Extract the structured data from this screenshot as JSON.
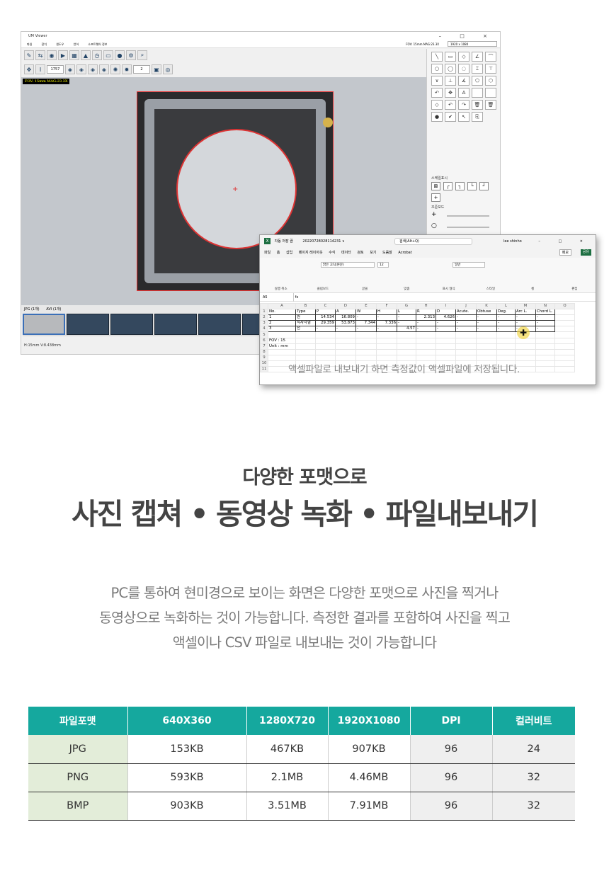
{
  "viewer": {
    "title": "UM Viewer",
    "window_controls": "– □ ×",
    "menu": [
      "파일",
      "장치",
      "윈도우",
      "언어",
      "소프트웨어 정보"
    ],
    "fov_mag": "FOV: 15mm   MAG:23.3X",
    "resolution": "1920 x 1080",
    "overlay_label": "FOV: 15mm MAG:23.3X",
    "zoom_field": "1757",
    "step_field": "2",
    "scale_panel_label": "스케일표시",
    "zoom_panel_label": "조준모드",
    "tabs": [
      "JPG (1개)",
      "AVI (1개)"
    ],
    "status": "H:15mm V:8.438mm"
  },
  "excel": {
    "autosave": "자동 저장",
    "toggle": "끔",
    "filename": "20220728028114231 ∨",
    "search_placeholder": "검색(Alt+Q)",
    "user": "lee shinho",
    "window_controls": "– □ ×",
    "menu": [
      "파일",
      "홈",
      "삽입",
      "페이지 레이아웃",
      "수식",
      "데이터",
      "검토",
      "보기",
      "도움말",
      "Acrobat"
    ],
    "memo": "메모",
    "share": "공유",
    "font_name": "맑은 고딕(본문)",
    "font_size": "12",
    "number_format": "일반",
    "ribbon_groups": [
      "실행 취소",
      "클립보드",
      "글꼴",
      "맞춤",
      "표시 형식",
      "스타일",
      "셀",
      "편집"
    ],
    "cell_ref": "A5",
    "fx": "fx",
    "columns": [
      "",
      "A",
      "B",
      "C",
      "D",
      "E",
      "F",
      "G",
      "H",
      "I",
      "J",
      "K",
      "L",
      "M",
      "N",
      "O"
    ],
    "rows": [
      [
        "1",
        "No.",
        "Type",
        "P",
        "A",
        "W",
        "H",
        "L",
        "R",
        "D",
        "Acute.",
        "Obtuse",
        "Deg.",
        "Arc L.",
        "Chord L.",
        ""
      ],
      [
        "2",
        "1",
        "원",
        "14.534",
        "16.809",
        "-",
        "-",
        "-",
        "2.313",
        "4.626",
        "-",
        "-",
        "-",
        "-",
        "-",
        ""
      ],
      [
        "3",
        "2",
        "직사각형",
        "29.359",
        "53.873",
        "7.344",
        "7.336",
        "-",
        "-",
        "-",
        "-",
        "-",
        "-",
        "-",
        "-",
        ""
      ],
      [
        "4",
        "3",
        "선",
        "-",
        "-",
        "-",
        "-",
        "4.57",
        "-",
        "-",
        "-",
        "-",
        "-",
        "-",
        "-",
        ""
      ],
      [
        "5",
        "",
        "",
        "",
        "",
        "",
        "",
        "",
        "",
        "",
        "",
        "",
        "",
        "",
        "",
        ""
      ],
      [
        "6",
        "FOV : 15",
        "",
        "",
        "",
        "",
        "",
        "",
        "",
        "",
        "",
        "",
        "",
        "",
        "",
        ""
      ],
      [
        "7",
        "Unit : mm",
        "",
        "",
        "",
        "",
        "",
        "",
        "",
        "",
        "",
        "",
        "",
        "",
        "",
        ""
      ],
      [
        "8",
        "",
        "",
        "",
        "",
        "",
        "",
        "",
        "",
        "",
        "",
        "",
        "",
        "",
        "",
        ""
      ],
      [
        "9",
        "",
        "",
        "",
        "",
        "",
        "",
        "",
        "",
        "",
        "",
        "",
        "",
        "",
        "",
        ""
      ],
      [
        "10",
        "",
        "",
        "",
        "",
        "",
        "",
        "",
        "",
        "",
        "",
        "",
        "",
        "",
        "",
        ""
      ],
      [
        "11",
        "",
        "",
        "",
        "",
        "",
        "",
        "",
        "",
        "",
        "",
        "",
        "",
        "",
        "",
        ""
      ]
    ],
    "note": "액셀파일로 내보내기 하면 측정값이 액셀파일에 저장됩니다."
  },
  "headings": {
    "sub": "다양한 포맷으로",
    "main": "사진 캡쳐 • 동영상 녹화 • 파일내보내기"
  },
  "description": [
    "PC를 통하여 현미경으로 보이는 화면은 다양한 포맷으로 사진을 찍거나",
    "동영상으로 녹화하는 것이 가능합니다. 측정한 결과를 포함하여 사진을 찍고",
    "액셀이나 CSV 파일로 내보내는 것이 가능합니다"
  ],
  "spec_table": {
    "headers": [
      "파일포맷",
      "640X360",
      "1280X720",
      "1920X1080",
      "DPI",
      "컬러비트"
    ],
    "rows": [
      [
        "JPG",
        "153KB",
        "467KB",
        "907KB",
        "96",
        "24"
      ],
      [
        "PNG",
        "593KB",
        "2.1MB",
        "4.46MB",
        "96",
        "32"
      ],
      [
        "BMP",
        "903KB",
        "3.51MB",
        "7.91MB",
        "96",
        "32"
      ]
    ]
  },
  "colors": {
    "table_header": "#15a89e",
    "format_cell": "#e3edd9",
    "excel_green": "#1d6f42"
  }
}
